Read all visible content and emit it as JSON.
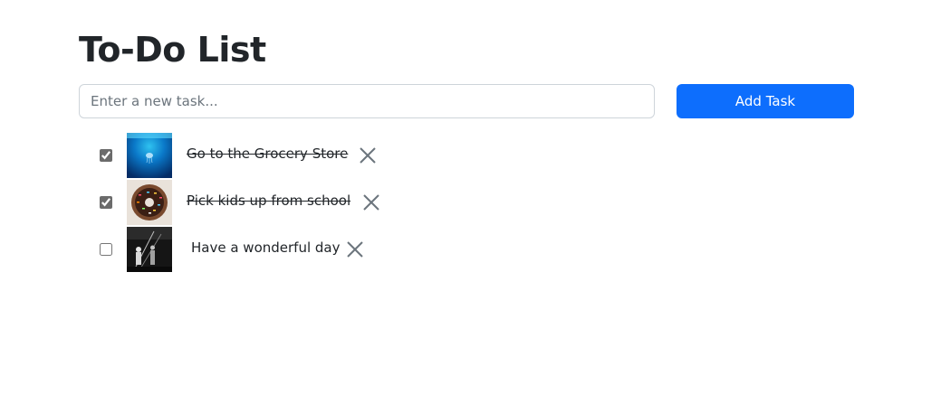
{
  "header": {
    "title": "To-Do List"
  },
  "form": {
    "input_placeholder": "Enter a new task...",
    "input_value": "",
    "add_button_label": "Add Task"
  },
  "tasks": [
    {
      "text": "Go to the Grocery Store",
      "completed": true,
      "image": "ocean-jellyfish-thumbnail"
    },
    {
      "text": "Pick kids up from school",
      "completed": true,
      "image": "sprinkled-donut-thumbnail"
    },
    {
      "text": "Have a wonderful day",
      "completed": false,
      "image": "black-white-street-thumbnail"
    }
  ],
  "icons": {
    "delete": "close-icon"
  },
  "colors": {
    "accent": "#0d6efd",
    "text": "#212529",
    "border": "#ced4da",
    "delete_icon": "#6c757d"
  }
}
